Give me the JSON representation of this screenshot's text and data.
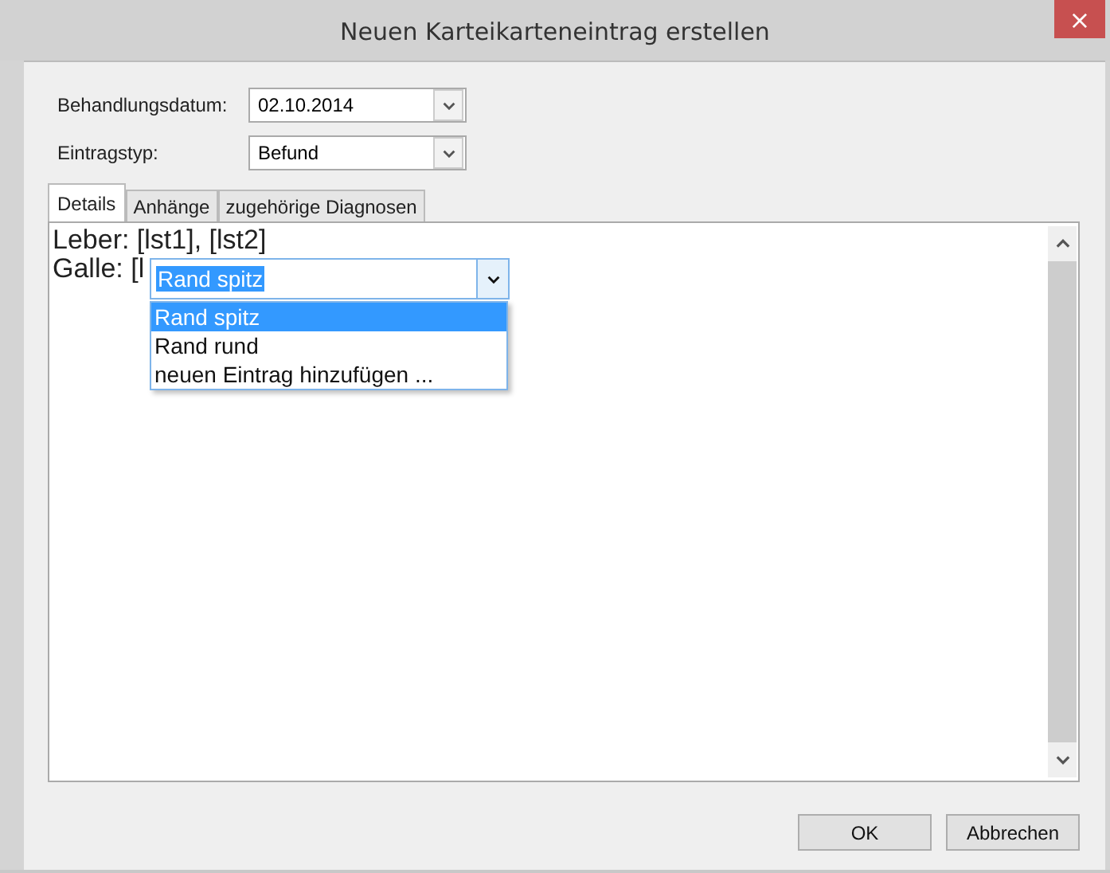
{
  "window": {
    "title": "Neuen Karteikarteneintrag erstellen",
    "close": "×"
  },
  "fields": [
    {
      "label": "Behandlungsdatum:",
      "value": "02.10.2014"
    },
    {
      "label": "Eintragstyp:",
      "value": "Befund"
    }
  ],
  "tabs": [
    {
      "label": "Details",
      "selected": true
    },
    {
      "label": "Anhänge",
      "selected": false
    },
    {
      "label": "zugehörige Diagnosen",
      "selected": false
    }
  ],
  "editor": {
    "lines": [
      "Leber: [lst1], [lst2]",
      "Galle: [l"
    ]
  },
  "dropdown": {
    "value": "Rand spitz",
    "options": [
      {
        "label": "Rand spitz",
        "selected": true
      },
      {
        "label": "Rand rund",
        "selected": false
      },
      {
        "label": "neuen Eintrag hinzufügen ...",
        "selected": false
      }
    ]
  },
  "buttons": [
    "OK",
    "Abbrechen"
  ]
}
